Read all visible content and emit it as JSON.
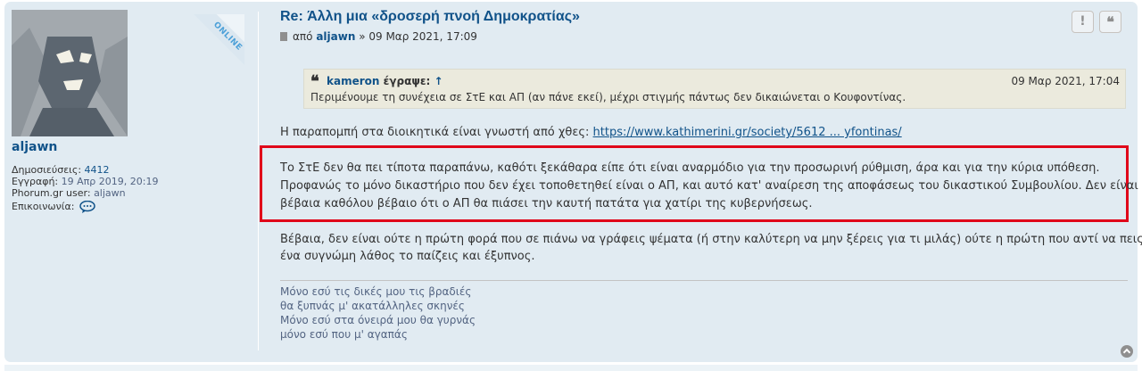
{
  "user": {
    "username": "aljawn",
    "online_label": "ONLINE",
    "posts_label": "Δημοσιεύσεις:",
    "posts_count": "4412",
    "joined_label": "Εγγραφή:",
    "joined_value": "19 Απρ 2019, 20:19",
    "phorum_label": "Phorum.gr user:",
    "phorum_value": "aljawn",
    "contact_label": "Επικοινωνία:"
  },
  "post": {
    "title": "Re: Άλλη μια «δροσερή πνοή Δημοκρατίας»",
    "by_label": "από",
    "author": "aljawn",
    "date": "» 09 Μαρ 2021, 17:09",
    "report_label": "!",
    "quote_label": "❝"
  },
  "quote": {
    "author": "kameron",
    "wrote_label": "έγραψε:",
    "arrow": "↑",
    "date": "09 Μαρ 2021, 17:04",
    "text": "Περιμένουμε τη συνέχεια σε ΣτΕ και ΑΠ (αν πάνε εκεί), μέχρι στιγμής πάντως δεν δικαιώνεται ο Κουφοντίνας."
  },
  "body": {
    "intro": "Η παραπομπή στα διοικητικά είναι γνωστή από χθες: ",
    "link": "https://www.kathimerini.gr/society/5612 ... yfontinas/",
    "highlight_lines": [
      "Το ΣτΕ δεν θα πει τίποτα παραπάνω, καθότι ξεκάθαρα είπε ότι είναι αναρμόδιο για την προσωρινή ρύθμιση, άρα και για την κύρια υπόθεση.",
      "Προφανώς το μόνο δικαστήριο που δεν έχει τοποθετηθεί είναι ο ΑΠ, και αυτό κατ' αναίρεση της αποφάσεως του δικαστικού Συμβουλίου. Δεν είναι",
      "βέβαια καθόλου βέβαιο ότι ο ΑΠ θα πιάσει την καυτή πατάτα για χατίρι της κυβερνήσεως."
    ],
    "closing_lines": [
      "Βέβαια, δεν είναι ούτε η πρώτη φορά που σε πιάνω να γράφεις ψέματα (ή στην καλύτερη να μην ξέρεις για τι μιλάς) ούτε η πρώτη που αντί να πεις",
      "ένα συγνώμη λάθος το παίζεις και έξυπνος."
    ]
  },
  "signature": [
    "Μόνο εσύ τις δικές μου τις βραδιές",
    "θα ξυπνάς μ' ακατάλληλες σκηνές",
    "Μόνο εσύ στα όνειρά μου θα γυρνάς",
    "μόνο εσύ που μ' αγαπάς"
  ],
  "colors": {
    "post_bg": "#e1ebf2",
    "link": "#105289",
    "highlight_border": "#e0061a",
    "quote_bg": "#ebeadd"
  }
}
